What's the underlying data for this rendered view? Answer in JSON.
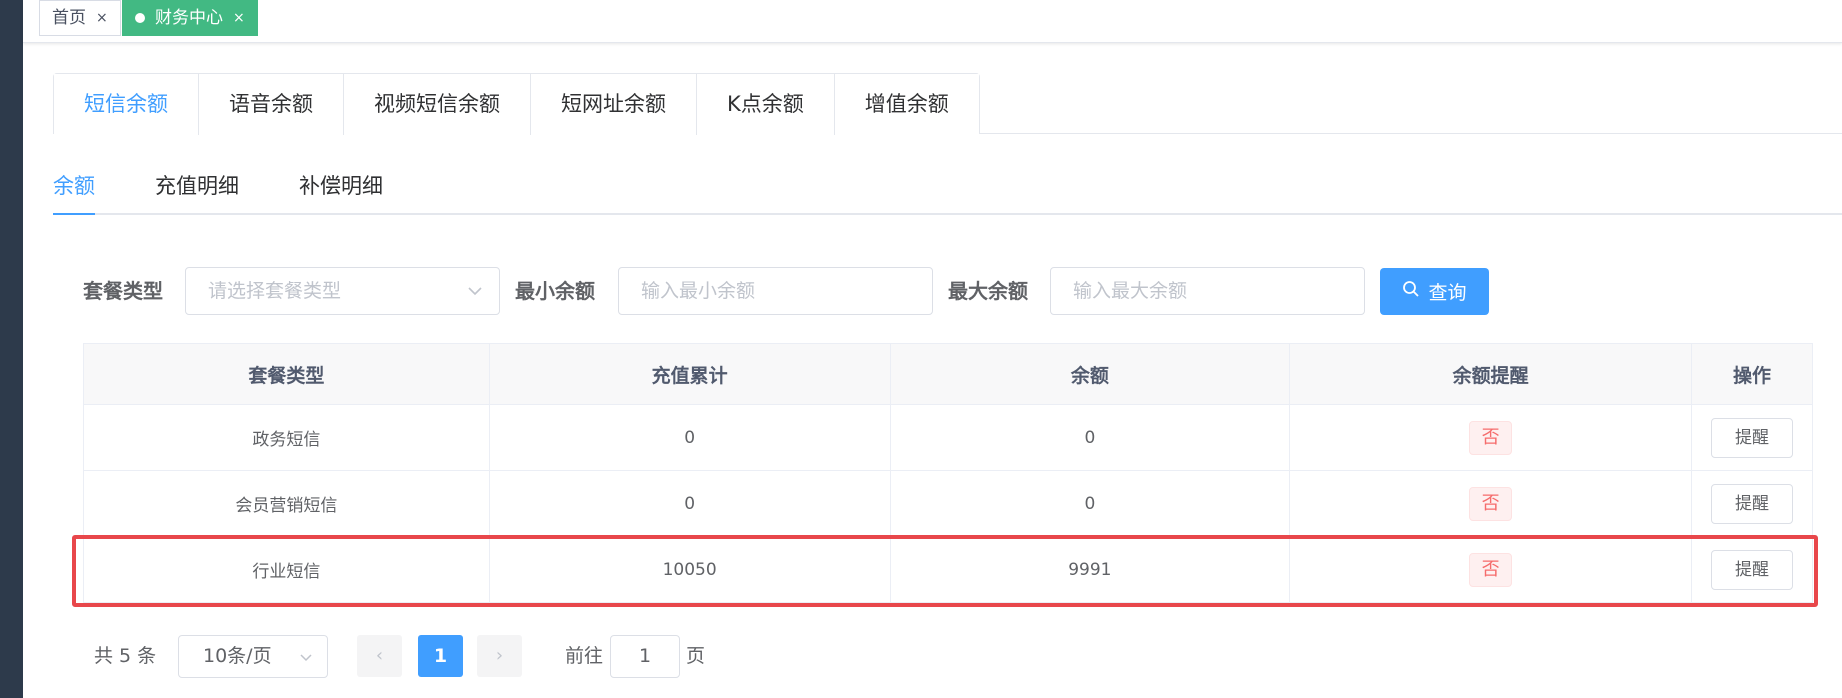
{
  "tags_view": {
    "items": [
      {
        "label": "首页",
        "close": "×"
      },
      {
        "label": "财务中心",
        "close": "×"
      }
    ]
  },
  "card_tabs": [
    "短信余额",
    "语音余额",
    "视频短信余额",
    "短网址余额",
    "K点余额",
    "增值余额"
  ],
  "sub_tabs": [
    "余额",
    "充值明细",
    "补偿明细"
  ],
  "search": {
    "package_type_label": "套餐类型",
    "package_type_placeholder": "请选择套餐类型",
    "min_label": "最小余额",
    "min_placeholder": "输入最小余额",
    "max_label": "最大余额",
    "max_placeholder": "输入最大余额",
    "query_button": "查询"
  },
  "table": {
    "columns": [
      "套餐类型",
      "充值累计",
      "余额",
      "余额提醒",
      "操作"
    ],
    "rows": [
      {
        "package": "政务短信",
        "recharge_total": "0",
        "balance": "0",
        "reminder": "否",
        "action": "提醒"
      },
      {
        "package": "会员营销短信",
        "recharge_total": "0",
        "balance": "0",
        "reminder": "否",
        "action": "提醒"
      },
      {
        "package": "行业短信",
        "recharge_total": "10050",
        "balance": "9991",
        "reminder": "否",
        "action": "提醒"
      }
    ]
  },
  "pagination": {
    "total": "共 5 条",
    "page_size": "10条/页",
    "current_page": "1",
    "goto_label": "前往",
    "goto_value": "1",
    "page_suffix": "页",
    "prev": "‹",
    "next": "›"
  },
  "colors": {
    "primary": "#409eff",
    "tag_active": "#42b983",
    "highlight": "#e8474b",
    "danger": "#f56c6c"
  }
}
